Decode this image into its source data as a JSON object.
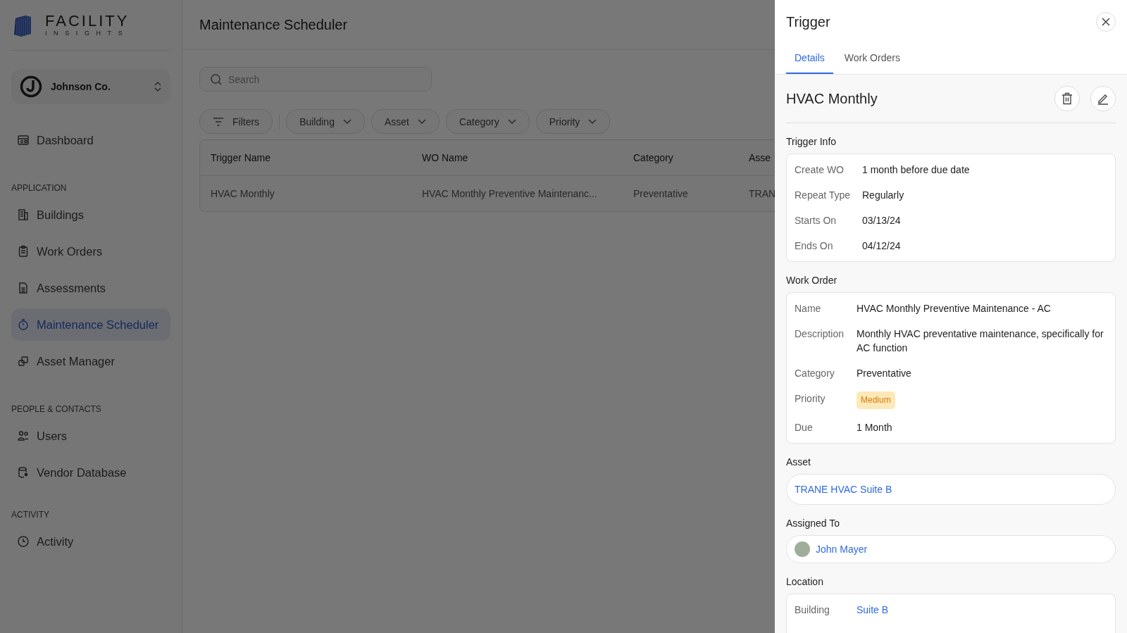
{
  "sidebar": {
    "logo": {
      "line1": "FACILITY",
      "line2": "INSIGHTS"
    },
    "organization": {
      "name": "Johnson Co."
    },
    "sections": [
      {
        "items": [
          {
            "label": "Dashboard",
            "selected": false
          }
        ]
      },
      {
        "heading": "APPLICATION",
        "items": [
          {
            "label": "Buildings",
            "selected": false
          },
          {
            "label": "Work Orders",
            "selected": false
          },
          {
            "label": "Assessments",
            "selected": false
          },
          {
            "label": "Maintenance Scheduler",
            "selected": true
          },
          {
            "label": "Asset Manager",
            "selected": false
          }
        ]
      },
      {
        "heading": "PEOPLE & CONTACTS",
        "items": [
          {
            "label": "Users",
            "selected": false
          },
          {
            "label": "Vendor Database",
            "selected": false
          }
        ]
      },
      {
        "heading": "ACTIVITY",
        "items": [
          {
            "label": "Activity",
            "selected": false
          }
        ]
      }
    ]
  },
  "page": {
    "title": "Maintenance Scheduler",
    "search": {
      "placeholder": "Search"
    },
    "filters": {
      "label": "Filters",
      "dropdowns": [
        "Building",
        "Asset",
        "Category",
        "Priority"
      ]
    },
    "table": {
      "columns": [
        "Trigger Name",
        "WO Name",
        "Category",
        "Asse"
      ],
      "rows": [
        [
          "HVAC Monthly",
          "HVAC Monthly Preventive Maintenanc...",
          "Preventative",
          "TRAN"
        ]
      ]
    }
  },
  "panel": {
    "title": "Trigger",
    "tabs": [
      {
        "label": "Details",
        "selected": true
      },
      {
        "label": "Work Orders",
        "selected": false
      }
    ],
    "name": "HVAC Monthly",
    "trigger_info": {
      "heading": "Trigger Info",
      "rows": [
        {
          "label": "Create WO",
          "value": "1 month before due date",
          "kind": "text"
        },
        {
          "label": "Repeat Type",
          "value": "Regularly",
          "kind": "text"
        },
        {
          "label": "Starts On",
          "value": "03/13/24",
          "kind": "text"
        },
        {
          "label": "Ends On",
          "value": "04/12/24",
          "kind": "text"
        }
      ]
    },
    "work_order": {
      "heading": "Work Order",
      "rows": [
        {
          "label": "Name",
          "value": "HVAC Monthly Preventive Maintenance - AC",
          "kind": "text"
        },
        {
          "label": "Description",
          "value": "Monthly HVAC preventative maintenance, specifically for AC function",
          "kind": "text"
        },
        {
          "label": "Category",
          "value": "Preventative",
          "kind": "text"
        },
        {
          "label": "Priority",
          "value": "Medium",
          "kind": "badge"
        },
        {
          "label": "Due",
          "value": "1 Month",
          "kind": "text"
        }
      ]
    },
    "asset": {
      "heading": "Asset",
      "value": "TRANE HVAC Suite B"
    },
    "assigned_to": {
      "heading": "Assigned To",
      "value": "John Mayer"
    },
    "location": {
      "heading": "Location",
      "rows": [
        {
          "label": "Building",
          "value": "Suite B",
          "kind": "link"
        }
      ]
    }
  }
}
